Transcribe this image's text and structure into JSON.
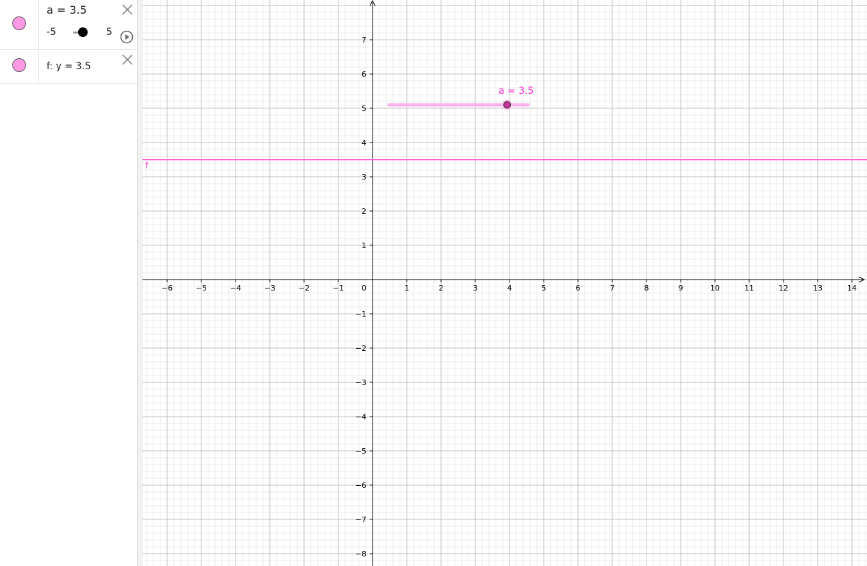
{
  "algebra": {
    "slider": {
      "expression": "a = 3.5",
      "min_label": "-5",
      "max_label": "5",
      "value": 3.5,
      "min": -5,
      "max": 5
    },
    "function": {
      "expression": "f: y = 3.5"
    }
  },
  "graphics": {
    "x_ticks": [
      "−6",
      "−5",
      "−4",
      "−3",
      "−2",
      "−1",
      "1",
      "2",
      "3",
      "4",
      "5",
      "6",
      "7",
      "8",
      "9",
      "10",
      "11",
      "12",
      "13",
      "14"
    ],
    "y_ticks_pos": [
      "1",
      "2",
      "3",
      "4",
      "5",
      "6",
      "7"
    ],
    "y_ticks_neg": [
      "−1",
      "−2",
      "−3",
      "−4",
      "−5",
      "−6",
      "−7",
      "−8"
    ],
    "origin_label": "0",
    "function_label": "f",
    "slider_label": "a = 3.5",
    "colors": {
      "object": "#ff66d9",
      "marble": "#ff99e6",
      "grid_minor": "#ebebeb",
      "grid_major": "#c0c0c0"
    }
  }
}
